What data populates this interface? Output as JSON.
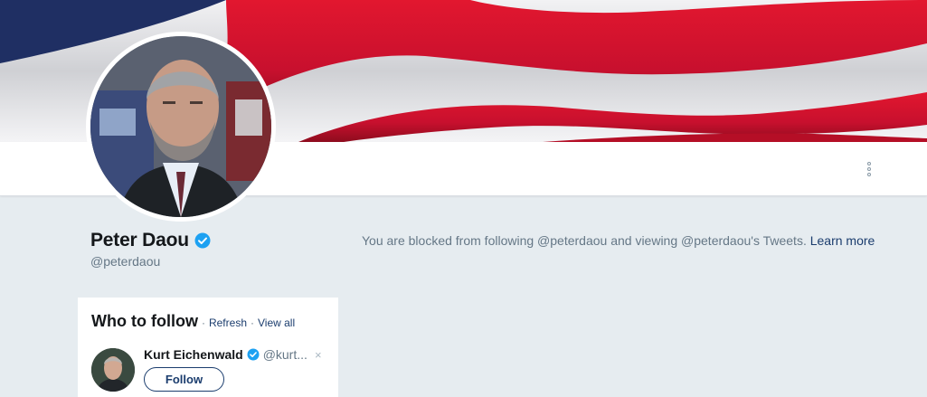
{
  "profile": {
    "name": "Peter Daou",
    "handle": "@peterdaou",
    "verified": true,
    "blocked_message": "You are blocked from following @peterdaou and viewing @peterdaou's Tweets.",
    "learn_more_label": "Learn more"
  },
  "who_to_follow": {
    "title": "Who to follow",
    "separator": "·",
    "refresh_label": "Refresh",
    "view_all_label": "View all",
    "suggestions": [
      {
        "name": "Kurt Eichenwald",
        "handle": "@kurt...",
        "verified": true,
        "follow_label": "Follow",
        "dismiss_glyph": "×"
      }
    ]
  },
  "icons": {
    "verified": "verified-badge-icon",
    "more": "more-vertical-icon",
    "dismiss": "close-icon"
  },
  "colors": {
    "page_background": "#e6ecf0",
    "verified_blue": "#1da1f2",
    "link_navy": "#1b3d6e",
    "muted_text": "#657786",
    "primary_text": "#14171a",
    "banner_red": "#c8102e",
    "banner_blue": "#1f2f63"
  }
}
